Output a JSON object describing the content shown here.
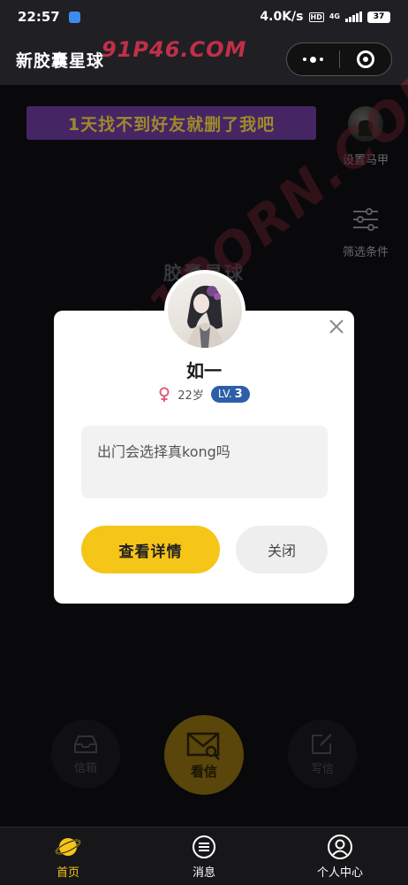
{
  "status_bar": {
    "time": "22:57",
    "speed": "4.0K/s",
    "hd": "HD",
    "network": "4G",
    "battery": "37"
  },
  "nav": {
    "title": "新胶囊星球"
  },
  "watermark": {
    "top": "91P46.COM",
    "diagonal": "91PORN.COM"
  },
  "banner": {
    "text": "1天找不到好友就删了我吧"
  },
  "side_tools": {
    "set_vest_label": "设置马甲",
    "filter_label": "筛选条件"
  },
  "background_title": "胶囊星球",
  "modal": {
    "name": "如一",
    "age": "22岁",
    "level_prefix": "LV.",
    "level": "3",
    "message": "出门会选择真kong吗",
    "detail_button": "查看详情",
    "close_button": "关闭"
  },
  "actions": {
    "inbox_label": "信箱",
    "view_label": "看信",
    "write_label": "写信"
  },
  "tabs": [
    {
      "label": "首页",
      "icon": "planet-icon",
      "active": true
    },
    {
      "label": "消息",
      "icon": "message-icon",
      "active": false
    },
    {
      "label": "个人中心",
      "icon": "profile-icon",
      "active": false
    }
  ],
  "colors": {
    "accent": "#f5c518",
    "banner_bg": "#6a3a9a",
    "banner_text": "#f3d243",
    "level_badge": "#2e5ea8",
    "female": "#e0607a"
  }
}
